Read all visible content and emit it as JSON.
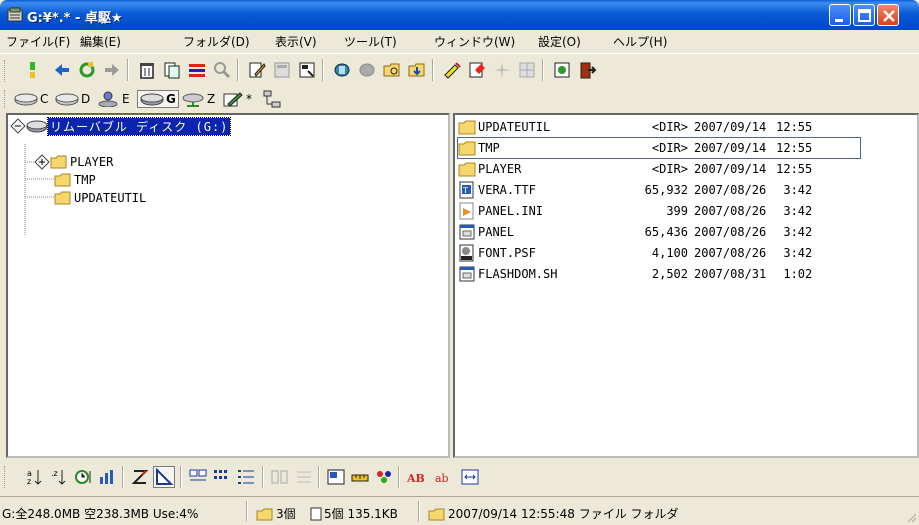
{
  "window": {
    "title": "G:¥*.* - 卓駆★"
  },
  "menu": {
    "file": "ファイル(F)",
    "edit": "編集(E)",
    "folder": "フォルダ(D)",
    "view": "表示(V)",
    "tools": "ツール(T)",
    "window": "ウィンドウ(W)",
    "settings": "設定(O)",
    "help": "ヘルプ(H)"
  },
  "drives": [
    {
      "letter": "C",
      "icon": "hard-drive-icon"
    },
    {
      "letter": "D",
      "icon": "hard-drive-icon"
    },
    {
      "letter": "E",
      "icon": "network-user-icon"
    },
    {
      "letter": "G",
      "icon": "removable-disk-icon",
      "active": true
    },
    {
      "letter": "Z",
      "icon": "network-drive-icon"
    },
    {
      "letter": "*",
      "icon": "pencil-icon"
    }
  ],
  "tree": {
    "root": "リムーバブル ディスク (G:)",
    "children": [
      "PLAYER",
      "TMP",
      "UPDATEUTIL"
    ]
  },
  "files": [
    {
      "name": "UPDATEUTIL",
      "size": "<DIR>",
      "date": "2007/09/14",
      "time": "12:55",
      "icon": "folder-icon"
    },
    {
      "name": "TMP",
      "size": "<DIR>",
      "date": "2007/09/14",
      "time": "12:55",
      "icon": "folder-icon"
    },
    {
      "name": "PLAYER",
      "size": "<DIR>",
      "date": "2007/09/14",
      "time": "12:55",
      "icon": "folder-icon"
    },
    {
      "name": "VERA.TTF",
      "size": "65,932",
      "date": "2007/08/26",
      "time": "3:42",
      "icon": "font-file-icon"
    },
    {
      "name": "PANEL.INI",
      "size": "399",
      "date": "2007/08/26",
      "time": "3:42",
      "icon": "settings-file-icon"
    },
    {
      "name": "PANEL",
      "size": "65,436",
      "date": "2007/08/26",
      "time": "3:42",
      "icon": "program-file-icon"
    },
    {
      "name": "FONT.PSF",
      "size": "4,100",
      "date": "2007/08/26",
      "time": "3:42",
      "icon": "psf-file-icon"
    },
    {
      "name": "FLASHDOM.SH",
      "size": "2,502",
      "date": "2007/08/31",
      "time": "1:02",
      "icon": "program-file-icon"
    }
  ],
  "status": {
    "disk": "G:全248.0MB 空238.3MB Use:4%",
    "folders": "3個",
    "files": "5個 135.1KB",
    "selected": "2007/09/14 12:55:48 ファイル フォルダ"
  },
  "colors": {
    "titlebar": "#0a5ad6",
    "selection": "#0a24b0"
  }
}
